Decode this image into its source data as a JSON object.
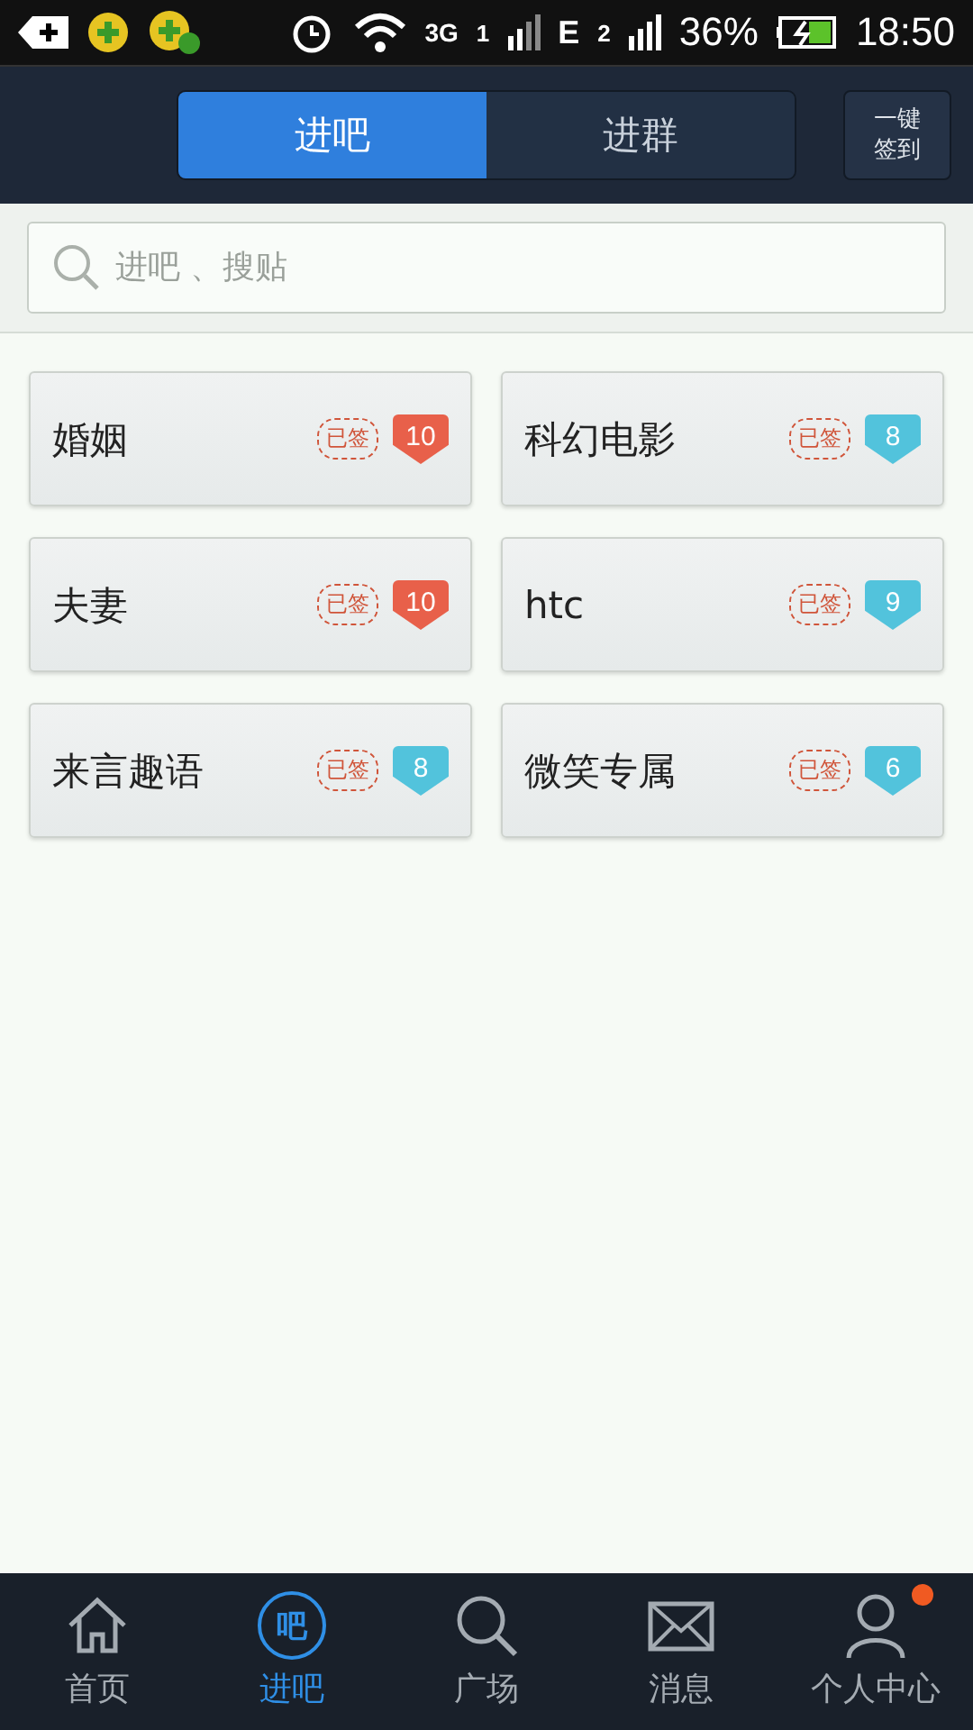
{
  "status_bar": {
    "network": "3G",
    "sim1": "1",
    "edge": "E",
    "sim2": "2",
    "battery": "36%",
    "time": "18:50"
  },
  "tabs": [
    {
      "label": "进吧",
      "selected": true
    },
    {
      "label": "进群",
      "selected": false
    }
  ],
  "sign_all_button": "一键签到",
  "search": {
    "placeholder": "进吧 、搜贴"
  },
  "forums": [
    {
      "name": "婚姻",
      "signed": true,
      "stamp": "已签",
      "level": "10",
      "color": "#e8604a"
    },
    {
      "name": "科幻电影",
      "signed": true,
      "stamp": "已签",
      "level": "8",
      "color": "#52c3dc"
    },
    {
      "name": "夫妻",
      "signed": true,
      "stamp": "已签",
      "level": "10",
      "color": "#e8604a"
    },
    {
      "name": "htc",
      "signed": true,
      "stamp": "已签",
      "level": "9",
      "color": "#52c3dc"
    },
    {
      "name": "来言趣语",
      "signed": true,
      "stamp": "已签",
      "level": "8",
      "color": "#52c3dc"
    },
    {
      "name": "微笑专属",
      "signed": true,
      "stamp": "已签",
      "level": "6",
      "color": "#52c3dc"
    }
  ],
  "nav": [
    {
      "kind": "home",
      "label": "首页",
      "selected": false,
      "dot": false
    },
    {
      "kind": "bar",
      "glyph": "吧",
      "label": "进吧",
      "selected": true,
      "dot": false
    },
    {
      "kind": "search",
      "label": "广场",
      "selected": false,
      "dot": false
    },
    {
      "kind": "mail",
      "label": "消息",
      "selected": false,
      "dot": false
    },
    {
      "kind": "person",
      "label": "个人中心",
      "selected": false,
      "dot": true
    }
  ]
}
